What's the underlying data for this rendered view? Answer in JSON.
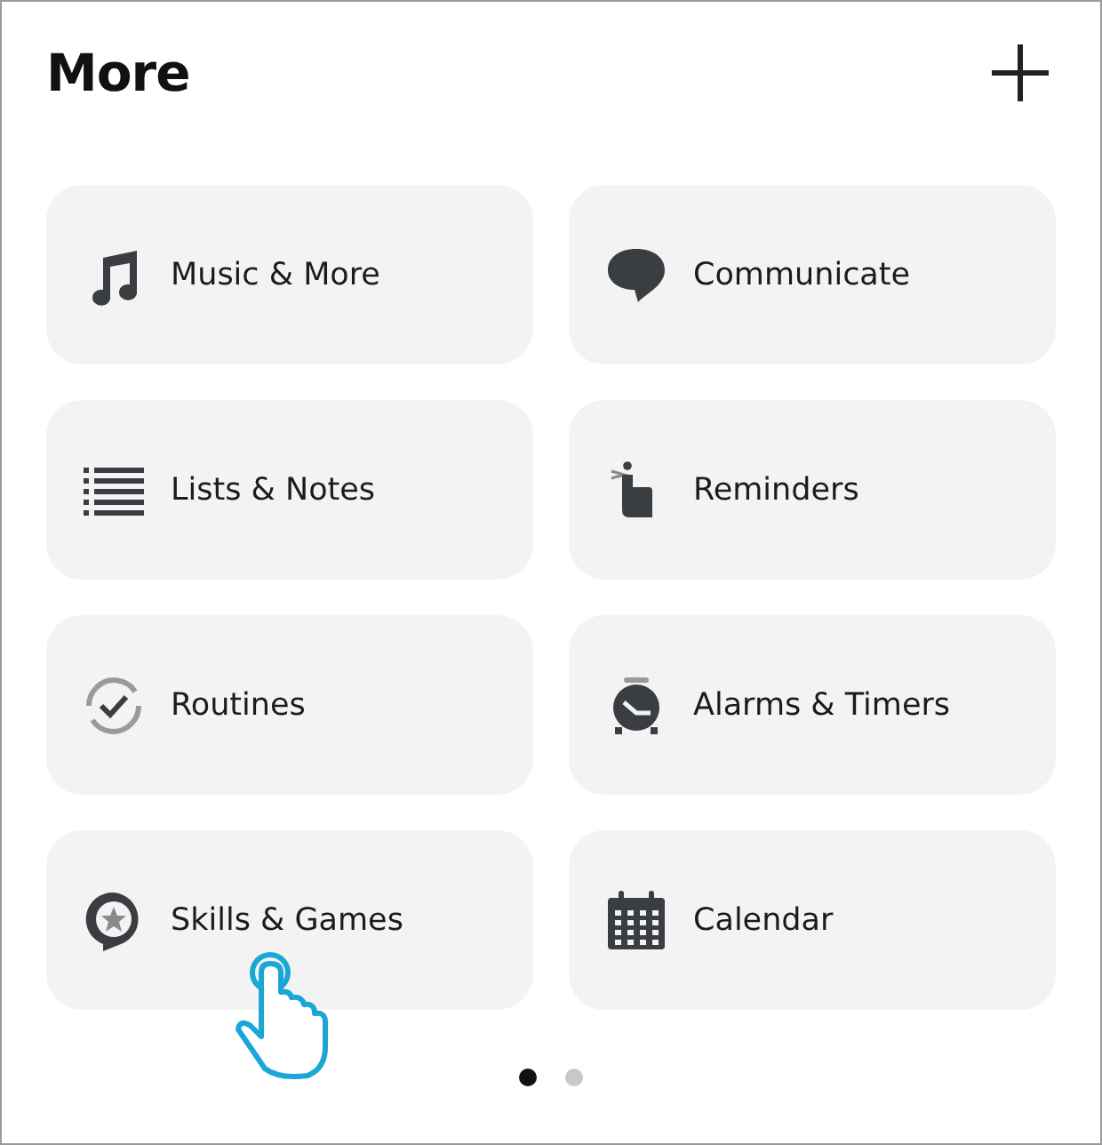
{
  "header": {
    "title": "More"
  },
  "tiles": [
    {
      "kind": "music",
      "label": "Music & More"
    },
    {
      "kind": "chat",
      "label": "Communicate"
    },
    {
      "kind": "list",
      "label": "Lists & Notes"
    },
    {
      "kind": "reminder",
      "label": "Reminders"
    },
    {
      "kind": "routine",
      "label": "Routines"
    },
    {
      "kind": "alarm",
      "label": "Alarms & Timers"
    },
    {
      "kind": "skills",
      "label": "Skills & Games"
    },
    {
      "kind": "calendar",
      "label": "Calendar"
    }
  ],
  "pager": [
    {
      "selected": true
    },
    {
      "selected": false
    }
  ]
}
